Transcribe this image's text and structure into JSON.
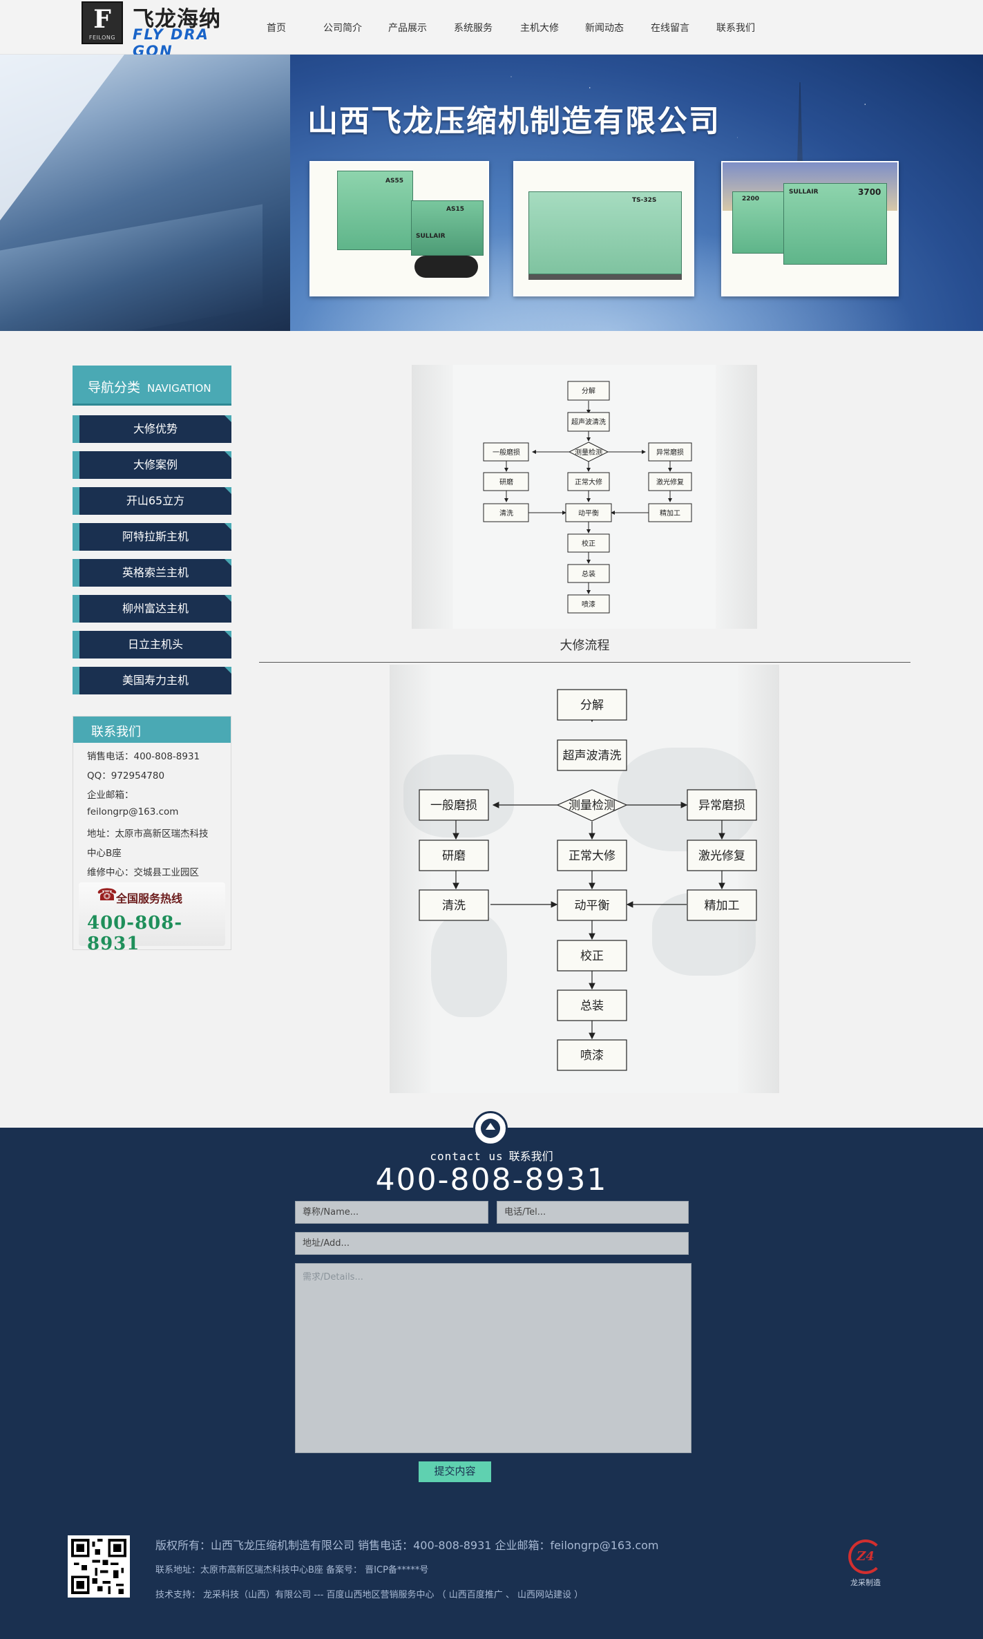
{
  "logo": {
    "mark_letter": "F",
    "mark_sub": "FEILONG",
    "cn": "飞龙海纳",
    "en": "FLY DRA GON"
  },
  "nav": [
    "首页",
    "公司简介",
    "产品展示",
    "系统服务",
    "主机大修",
    "新闻动态",
    "在线留言",
    "联系我们"
  ],
  "banner": {
    "title": "山西飞龙压缩机制造有限公司",
    "products": [
      {
        "labels": [
          "AS55",
          "AS15",
          "SULLAIR"
        ]
      },
      {
        "labels": [
          "TS-32S"
        ]
      },
      {
        "labels": [
          "SULLAIR",
          "3700",
          "2200"
        ]
      }
    ]
  },
  "sidebar": {
    "heading": "导航分类",
    "heading_en": "NAVIGATION",
    "items": [
      "大修优势",
      "大修案例",
      "开山65立方",
      "阿特拉斯主机",
      "英格索兰主机",
      "柳州富达主机",
      "日立主机头",
      "美国寿力主机"
    ]
  },
  "contact_box": {
    "heading": "联系我们",
    "lines": [
      "销售电话：400-808-8931",
      "QQ：972954780",
      "企业邮箱：",
      "feilongrp@163.com",
      "地址：太原市高新区瑞杰科技",
      "中心B座",
      "维修中心：交城县工业园区"
    ],
    "hotline_label": "全国服务热线",
    "hotline_number": "400-808-8931"
  },
  "flowchart": {
    "steps": [
      "分解",
      "超声波清洗",
      "测量检测",
      "一般磨损",
      "异常磨损",
      "研磨",
      "正常大修",
      "激光修复",
      "清洗",
      "动平衡",
      "精加工",
      "校正",
      "总装",
      "喷漆"
    ],
    "caption": "大修流程"
  },
  "footer_contact": {
    "title_en": "contact us",
    "title_cn": "联系我们",
    "phone": "400-808-8931",
    "name_placeholder": "尊称/Name...",
    "tel_placeholder": "电话/Tel...",
    "address_placeholder": "地址/Add...",
    "details_placeholder": "需求/Details...",
    "submit_label": "提交内容"
  },
  "footer": {
    "copyright": "版权所有：山西飞龙压缩机制造有限公司  销售电话：400-808-8931 企业邮箱：feilongrp@163.com",
    "address": "联系地址：太原市高新区瑞杰科技中心B座 备案号： 晋ICP备*****号",
    "support": "技术支持： 龙采科技（山西）有限公司 --- 百度山西地区营销服务中心 （ 山西百度推广 、 山西网站建设 ）",
    "brand_text": "龙采制造",
    "brand_mark": "Z4"
  },
  "colors": {
    "navy": "#1a3050",
    "teal": "#4aa9b4",
    "submit_green": "#5fd1b0",
    "hotline_green": "#1e8f5a"
  }
}
